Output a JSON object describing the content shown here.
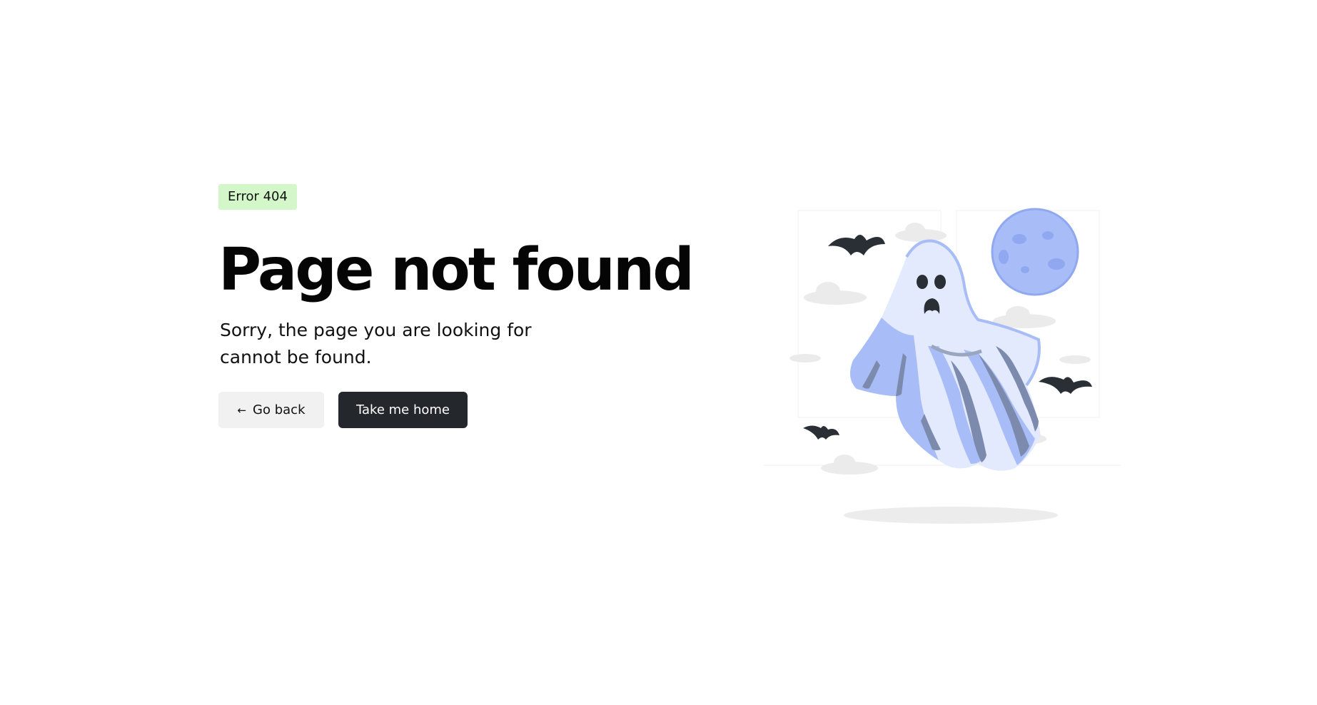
{
  "badge": {
    "text": "Error 404",
    "bg_color": "#d4f7c9"
  },
  "heading": {
    "title": "Page not found"
  },
  "message": {
    "text": "Sorry, the page you are looking for cannot be found."
  },
  "actions": {
    "back_icon": "arrow-left-icon",
    "back_label": "Go back",
    "home_label": "Take me home",
    "home_bg_color": "#24282c"
  },
  "illustration": {
    "subject": "ghost-illustration",
    "elements": [
      "ghost",
      "moon",
      "bats",
      "clouds"
    ],
    "accent_color": "#a8bdf7"
  }
}
